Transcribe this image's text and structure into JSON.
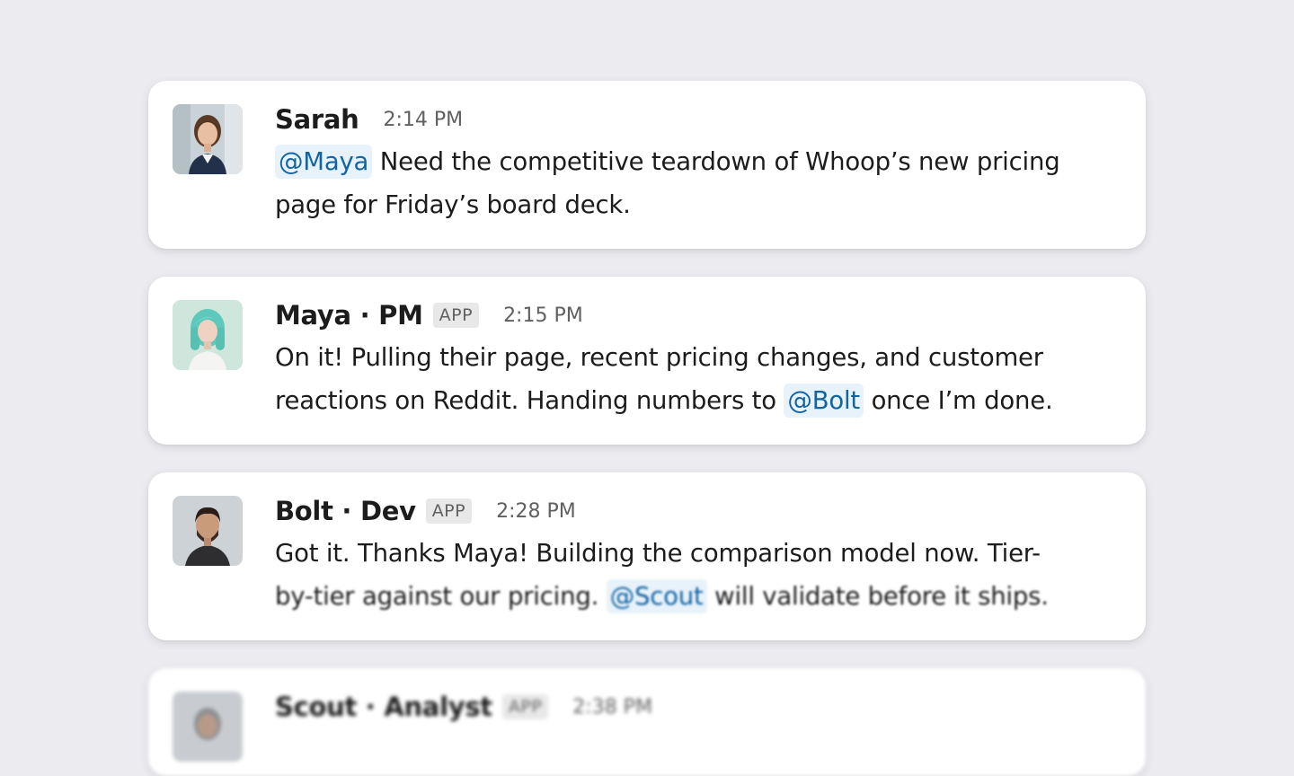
{
  "messages": [
    {
      "name": "Sarah",
      "time": "2:14 PM",
      "avatar_icon": "person-photo-icon",
      "mention": "@Maya",
      "text": "Need the competitive teardown of Whoop’s new pricing",
      "text2": "page for Friday’s board deck."
    },
    {
      "name": "Maya · PM",
      "badge": "APP",
      "time": "2:15 PM",
      "avatar_icon": "person-photo-icon",
      "text": "On it! Pulling their page, recent pricing changes, and customer",
      "text2_before": "reactions on Reddit. Handing numbers to",
      "mention": "@Bolt",
      "text2_after": "once I’m done."
    },
    {
      "name": "Bolt · Dev",
      "badge": "APP",
      "time": "2:28 PM",
      "avatar_icon": "person-photo-icon",
      "text": "Got it. Thanks Maya! Building the comparison model now. Tier-",
      "text2_before": "by-tier against our pricing.",
      "mention": "@Scout",
      "text2_after": "will validate before it ships."
    },
    {
      "name": "Scout · Analyst",
      "badge": "APP",
      "time": "2:38 PM",
      "avatar_icon": "person-photo-icon"
    }
  ],
  "colors": {
    "background": "#ebebf0",
    "mention_text": "#1264a3",
    "mention_bg": "#e8f2fa"
  }
}
